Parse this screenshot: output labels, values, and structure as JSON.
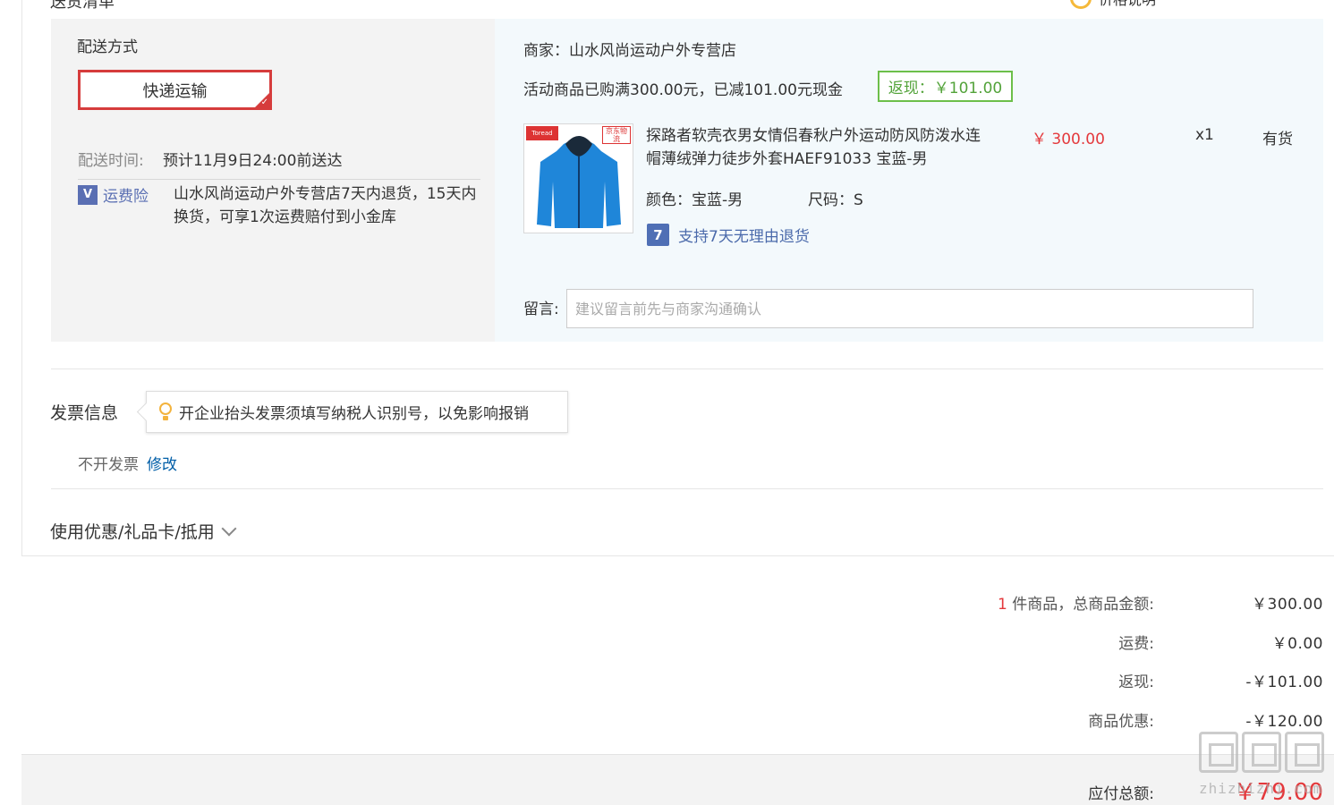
{
  "top": {
    "left_cut": "送货清单",
    "right_cut": "价格说明"
  },
  "shipping": {
    "title": "配送方式",
    "option": "快递运输",
    "time_label": "配送时间:",
    "time_value": "预计11月9日24:00前送达",
    "insurance_label": "运费险",
    "insurance_text": "山水风尚运动户外专营店7天内退货，15天内换货，可享1次运费赔付到小金库"
  },
  "merchant": {
    "name": "商家：山水风尚运动户外专营店",
    "promo": "活动商品已购满300.00元，已减101.00元现金",
    "rebate": "返现：￥101.00"
  },
  "product": {
    "title": "探路者软壳衣男女情侣春秋户外运动防风防泼水连帽薄绒弹力徒步外套HAEF91033 宝蓝-男",
    "price": "￥ 300.00",
    "qty": "x1",
    "stock": "有货",
    "color": "颜色：宝蓝-男",
    "size": "尺码：S",
    "return_policy": "支持7天无理由退货",
    "img_tag_left": "Toread",
    "img_tag_right": "京东物流",
    "jacket_color": "#1f86d9"
  },
  "memo": {
    "label": "留言:",
    "placeholder": "建议留言前先与商家沟通确认"
  },
  "invoice": {
    "title": "发票信息",
    "tip": "开企业抬头发票须填写纳税人识别号，以免影响报销",
    "status": "不开发票",
    "edit": "修改"
  },
  "coupon": {
    "label": "使用优惠/礼品卡/抵用"
  },
  "summary": {
    "count": "1",
    "items_label": "件商品，总商品金额:",
    "items_value": "￥300.00",
    "freight_label": "运费:",
    "freight_value": "￥0.00",
    "rebate_label": "返现:",
    "rebate_value": "-￥101.00",
    "discount_label": "商品优惠:",
    "discount_value": "-￥120.00",
    "total_label": "应付总额:",
    "total_value": "￥79.00"
  },
  "watermark": {
    "text": "zhizhizhi.com"
  },
  "colors": {
    "accent_red": "#e4393c",
    "rebate_green": "#53a33a",
    "link_blue": "#005ea7"
  }
}
